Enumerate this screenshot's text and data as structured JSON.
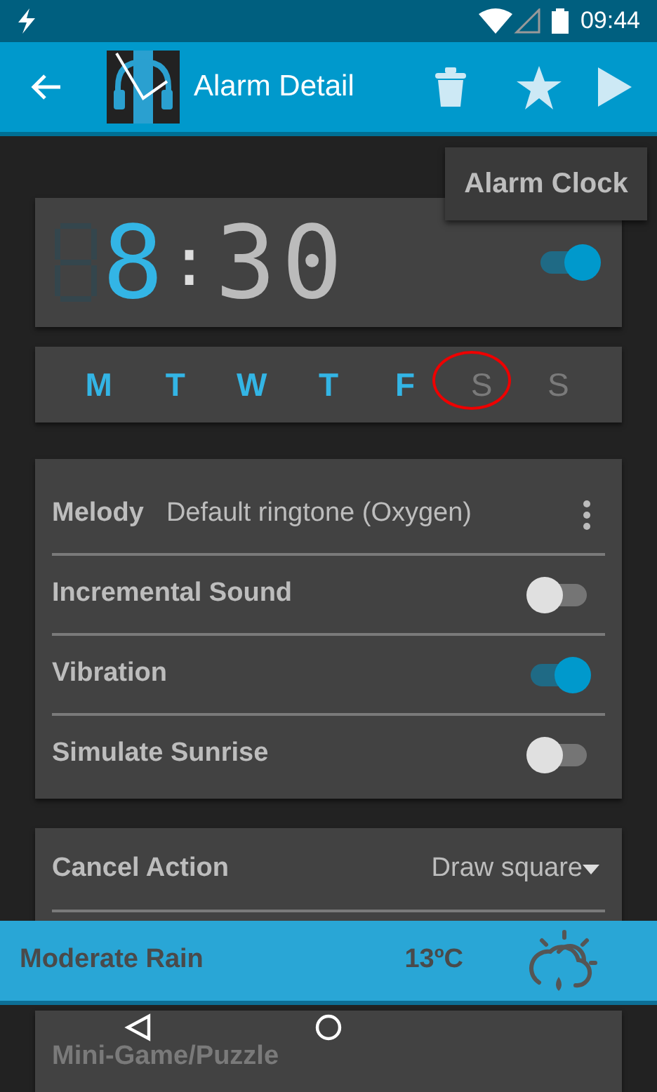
{
  "status_bar": {
    "time": "09:44"
  },
  "app_bar": {
    "title": "Alarm Detail"
  },
  "tooltip": "Alarm Clock",
  "alarm": {
    "hour": "8",
    "separator": ":",
    "minutes": "30",
    "enabled": true
  },
  "days": [
    {
      "label": "M",
      "selected": true,
      "circled": false
    },
    {
      "label": "T",
      "selected": true,
      "circled": false
    },
    {
      "label": "W",
      "selected": true,
      "circled": false
    },
    {
      "label": "T",
      "selected": true,
      "circled": false
    },
    {
      "label": "F",
      "selected": true,
      "circled": false
    },
    {
      "label": "S",
      "selected": false,
      "circled": true
    },
    {
      "label": "S",
      "selected": false,
      "circled": false
    }
  ],
  "settings": [
    {
      "kind": "menu",
      "label": "Melody",
      "value": "Default ringtone (Oxygen)"
    },
    {
      "kind": "toggle",
      "label": "Incremental Sound",
      "on": false
    },
    {
      "kind": "toggle",
      "label": "Vibration",
      "on": true
    },
    {
      "kind": "toggle",
      "label": "Simulate Sunrise",
      "on": false
    }
  ],
  "cancel_action": {
    "label": "Cancel Action",
    "value": "Draw square"
  },
  "weather": {
    "condition": "Moderate Rain",
    "temperature": "13ºC"
  },
  "next_row": {
    "label": "Mini-Game/Puzzle",
    "disabled": true
  }
}
